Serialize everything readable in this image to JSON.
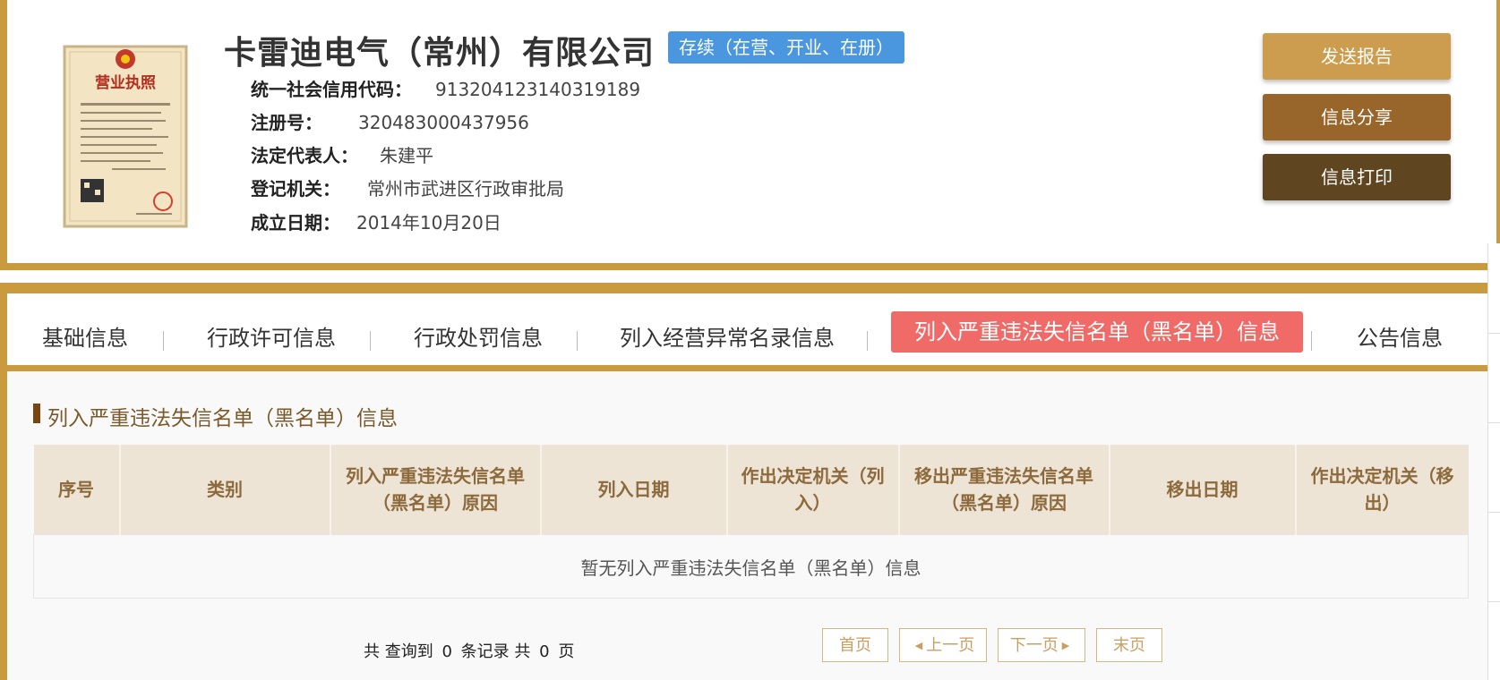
{
  "company": {
    "name": "卡雷迪电气（常州）有限公司",
    "status": "存续（在营、开业、在册）",
    "credit_code_label": "统一社会信用代码：",
    "credit_code": "913204123140319189",
    "reg_no_label": "注册号：",
    "reg_no": "320483000437956",
    "legal_rep_label": "法定代表人：",
    "legal_rep": "朱建平",
    "authority_label": "登记机关：",
    "authority": "常州市武进区行政审批局",
    "established_label": "成立日期：",
    "established": "2014年10月20日",
    "license_title": "营业执照"
  },
  "actions": {
    "send_report": "发送报告",
    "share": "信息分享",
    "print": "信息打印"
  },
  "tabs": [
    {
      "label": "基础信息"
    },
    {
      "label": "行政许可信息"
    },
    {
      "label": "行政处罚信息"
    },
    {
      "label": "列入经营异常名录信息"
    },
    {
      "label": "列入严重违法失信名单（黑名单）信息",
      "active": true
    },
    {
      "label": "公告信息"
    }
  ],
  "section": {
    "title": "列入严重违法失信名单（黑名单）信息",
    "columns": [
      "序号",
      "类别",
      "列入严重违法失信名单（黑名单）原因",
      "列入日期",
      "作出决定机关（列入）",
      "移出严重违法失信名单（黑名单）原因",
      "移出日期",
      "作出决定机关（移出）"
    ],
    "empty_text": "暂无列入严重违法失信名单（黑名单）信息"
  },
  "pager": {
    "summary_prefix": "共 查询到",
    "record_count": "0",
    "summary_mid": "条记录 共",
    "page_count": "0",
    "summary_suffix": "页",
    "first": "首页",
    "prev": "上一页",
    "next": "下一页",
    "last": "末页"
  },
  "colors": {
    "gold": "#c99b3e",
    "status_blue": "#4a97e0",
    "active_tab": "#f06a67",
    "btn_report": "#cc9d4e",
    "btn_share": "#98662a",
    "btn_print": "#5f4520"
  }
}
